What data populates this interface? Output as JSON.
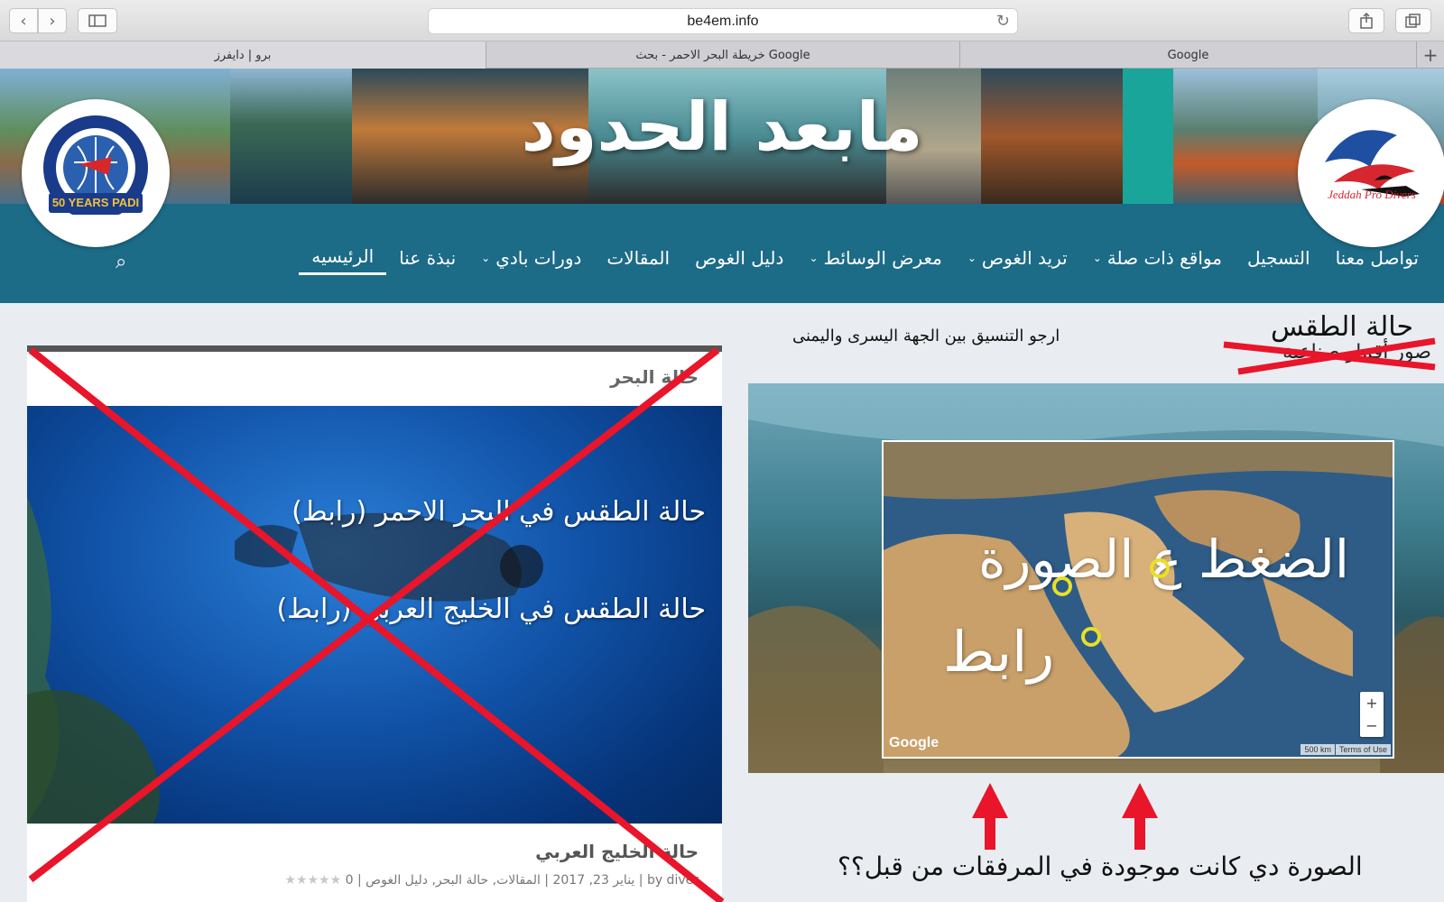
{
  "browser": {
    "url": "be4em.info",
    "tabs": [
      "برو | دايفرز",
      "خريطة البحر الاحمر - بحث Google",
      "Google"
    ],
    "accent": "#e8152b"
  },
  "site": {
    "title": "مابعد الحدود",
    "logo_left_text": "50 YEARS PADI",
    "logo_right_text": "Jeddah Pro Divers",
    "nav": [
      {
        "label": "الرئيسيه",
        "active": true,
        "dropdown": false
      },
      {
        "label": "نبذة عنا",
        "active": false,
        "dropdown": false
      },
      {
        "label": "دورات بادي",
        "active": false,
        "dropdown": true
      },
      {
        "label": "المقالات",
        "active": false,
        "dropdown": false
      },
      {
        "label": "دليل الغوص",
        "active": false,
        "dropdown": false
      },
      {
        "label": "معرض الوسائط",
        "active": false,
        "dropdown": true
      },
      {
        "label": "تريد الغوص",
        "active": false,
        "dropdown": true
      },
      {
        "label": "مواقع ذات صلة",
        "active": false,
        "dropdown": true
      },
      {
        "label": "التسجيل",
        "active": false,
        "dropdown": false
      },
      {
        "label": "تواصل معنا",
        "active": false,
        "dropdown": false
      }
    ],
    "nav_color": "#1c6b87"
  },
  "content": {
    "coordination_note": "ارجو التنسيق بين الجهة اليسرى واليمنى",
    "weather_heading": "حالة الطقس",
    "weather_sub": "صور أقمار صناعية",
    "map_text_1": "الضغط ع الصورة",
    "map_text_2": "رابط",
    "map_google": "Google",
    "map_scale": "500 km",
    "map_terms": "Terms of Use",
    "card_title": "حالة البحر",
    "card_link_1": "حالة الطقس في البحر الاحمر (رابط)",
    "card_link_2": "حالة الطقس في الخليج العربي (رابط)",
    "post_title": "حالة الخليج العربي",
    "post_meta": "by diver | يناير 23, 2017 | المقالات, حالة البحر, دليل الغوص | 0",
    "question": "الصورة دي كانت موجودة في المرفقات من قبل؟؟"
  }
}
